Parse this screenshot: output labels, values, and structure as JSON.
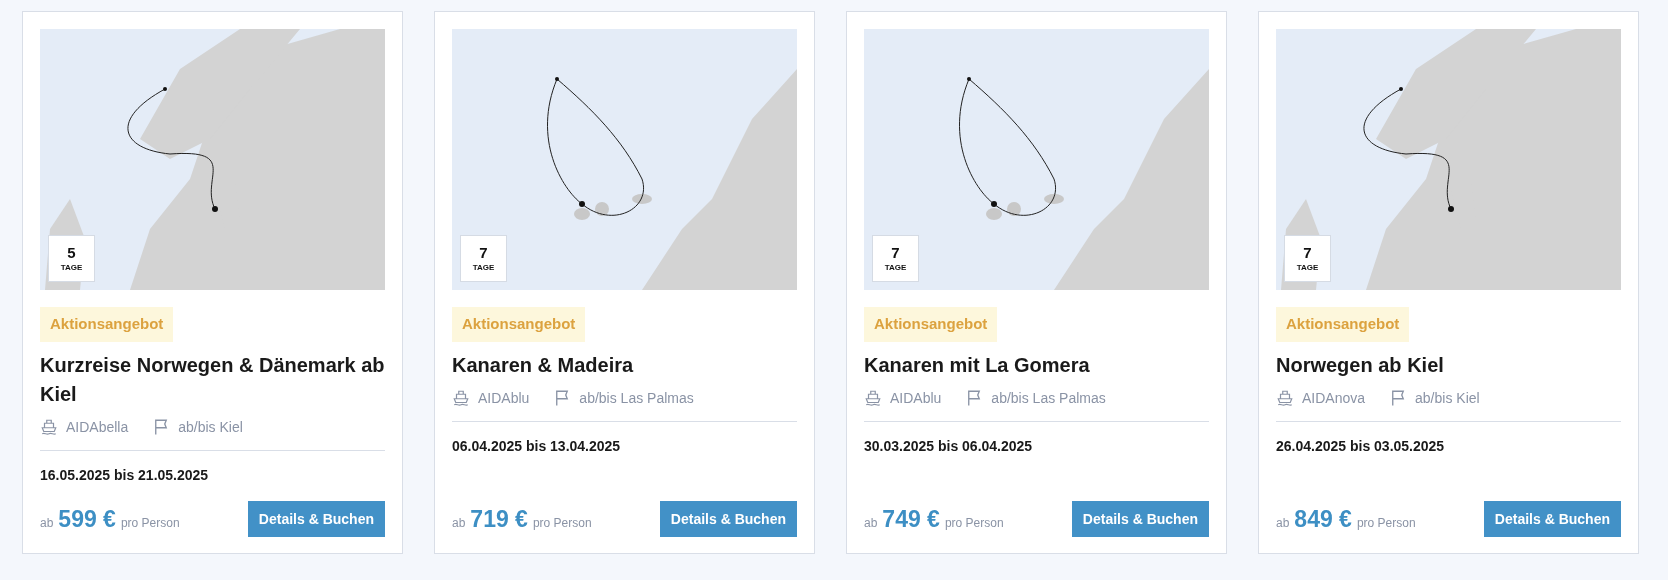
{
  "cruises": [
    {
      "days": "5",
      "days_unit": "TAGE",
      "badge": "Aktionsangebot",
      "title": "Kurzreise Norwegen & Dänemark ab Kiel",
      "ship": "AIDAbella",
      "port": "ab/bis Kiel",
      "dates": "16.05.2025 bis 21.05.2025",
      "price_prefix": "ab",
      "price": "599 €",
      "price_suffix": "pro Person",
      "button": "Details & Buchen"
    },
    {
      "days": "7",
      "days_unit": "TAGE",
      "badge": "Aktionsangebot",
      "title": "Kanaren & Madeira",
      "ship": "AIDAblu",
      "port": "ab/bis Las Palmas",
      "dates": "06.04.2025 bis 13.04.2025",
      "price_prefix": "ab",
      "price": "719 €",
      "price_suffix": "pro Person",
      "button": "Details & Buchen"
    },
    {
      "days": "7",
      "days_unit": "TAGE",
      "badge": "Aktionsangebot",
      "title": "Kanaren mit La Gomera",
      "ship": "AIDAblu",
      "port": "ab/bis Las Palmas",
      "dates": "30.03.2025 bis 06.04.2025",
      "price_prefix": "ab",
      "price": "749 €",
      "price_suffix": "pro Person",
      "button": "Details & Buchen"
    },
    {
      "days": "7",
      "days_unit": "TAGE",
      "badge": "Aktionsangebot",
      "title": "Norwegen ab Kiel",
      "ship": "AIDAnova",
      "port": "ab/bis Kiel",
      "dates": "26.04.2025 bis 03.05.2025",
      "price_prefix": "ab",
      "price": "849 €",
      "price_suffix": "pro Person",
      "button": "Details & Buchen"
    }
  ]
}
